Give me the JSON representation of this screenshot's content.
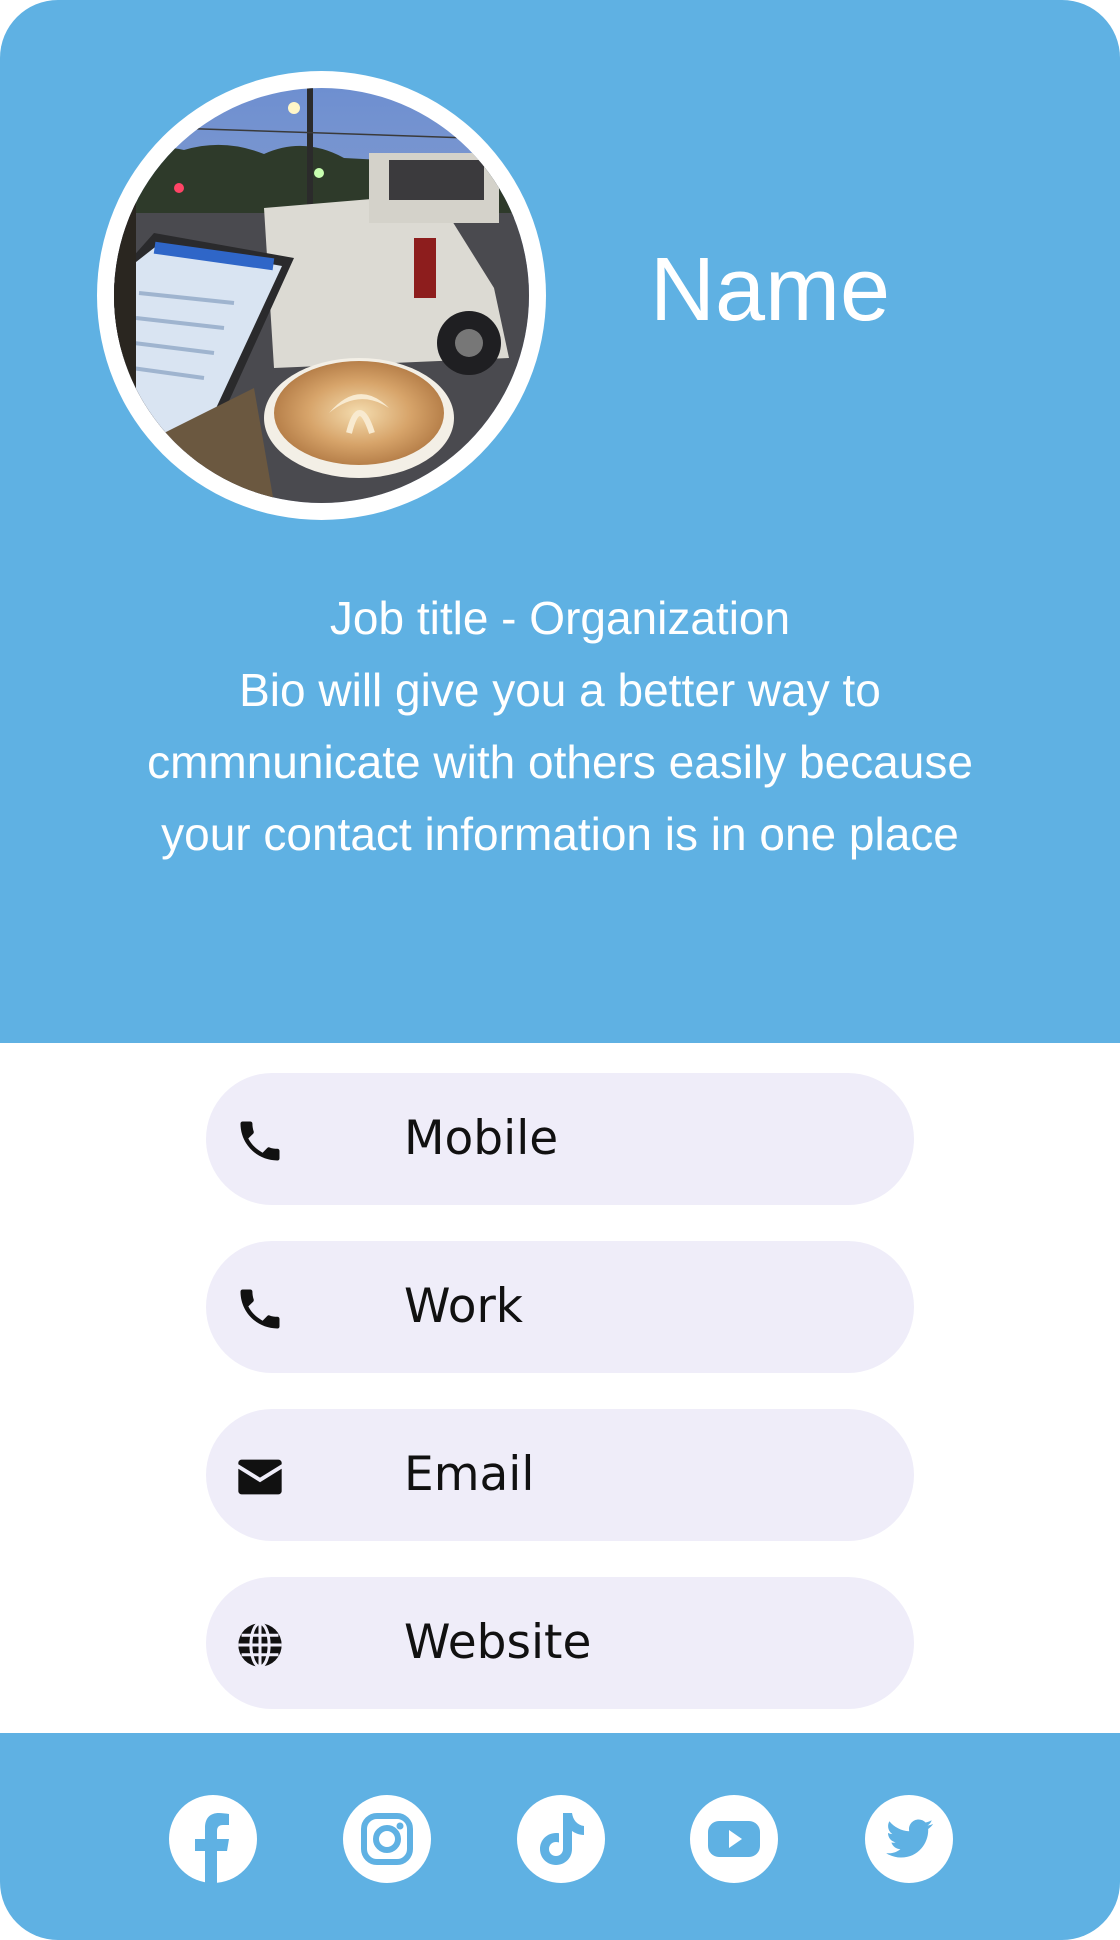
{
  "profile": {
    "name": "Name",
    "job_title": "Job title - Organization",
    "bio_lines": [
      "Bio will give you a better way to",
      "cmmnunicate with others easily because",
      "your contact information is in one place"
    ]
  },
  "contacts": [
    {
      "label": "Mobile",
      "icon": "phone-icon"
    },
    {
      "label": "Work",
      "icon": "phone-icon"
    },
    {
      "label": "Email",
      "icon": "envelope-icon"
    },
    {
      "label": "Website",
      "icon": "globe-icon"
    }
  ],
  "social": [
    {
      "icon": "facebook-icon"
    },
    {
      "icon": "instagram-icon"
    },
    {
      "icon": "tiktok-icon"
    },
    {
      "icon": "youtube-icon"
    },
    {
      "icon": "twitter-icon"
    }
  ],
  "colors": {
    "primary": "#5fb1e3",
    "button_bg": "#efedf9",
    "text_dark": "#111111",
    "white": "#ffffff"
  }
}
